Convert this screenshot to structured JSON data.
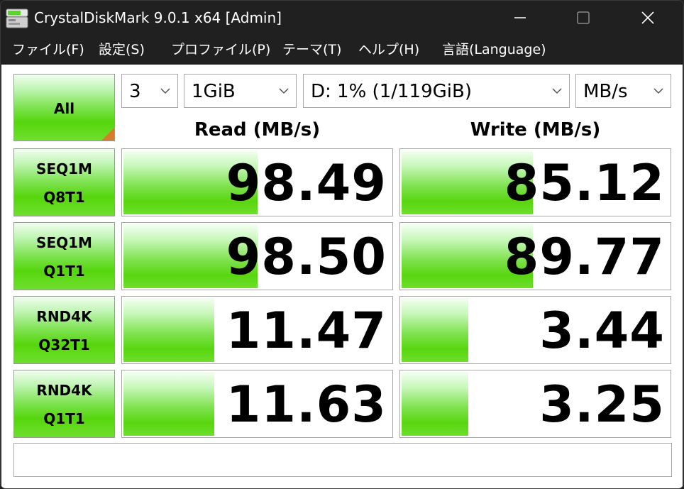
{
  "window": {
    "title": "CrystalDiskMark 9.0.1 x64 [Admin]"
  },
  "menu": [
    {
      "label": "ファイル(F)"
    },
    {
      "label": "設定(S)"
    },
    {
      "label": "プロファイル(P)"
    },
    {
      "label": "テーマ(T)"
    },
    {
      "label": "ヘルプ(H)"
    },
    {
      "label": "言語(Language)"
    }
  ],
  "controls": {
    "all_label": "All",
    "count": "3",
    "size": "1GiB",
    "drive": "D: 1% (1/119GiB)",
    "unit": "MB/s"
  },
  "headers": {
    "read": "Read (MB/s)",
    "write": "Write (MB/s)"
  },
  "tests": [
    {
      "line1": "SEQ1M",
      "line2": "Q8T1",
      "read": "98.49",
      "write": "85.12",
      "read_fill": 0.5,
      "write_fill": 0.49
    },
    {
      "line1": "SEQ1M",
      "line2": "Q1T1",
      "read": "98.50",
      "write": "89.77",
      "read_fill": 0.5,
      "write_fill": 0.49
    },
    {
      "line1": "RND4K",
      "line2": "Q32T1",
      "read": "11.47",
      "write": "3.44",
      "read_fill": 0.34,
      "write_fill": 0.25
    },
    {
      "line1": "RND4K",
      "line2": "Q1T1",
      "read": "11.63",
      "write": "3.25",
      "read_fill": 0.34,
      "write_fill": 0.25
    }
  ],
  "comment": "",
  "colors": {
    "titlebar": "#202020",
    "bar_green": "#58d60f",
    "corner_orange": "#d97a2c"
  }
}
